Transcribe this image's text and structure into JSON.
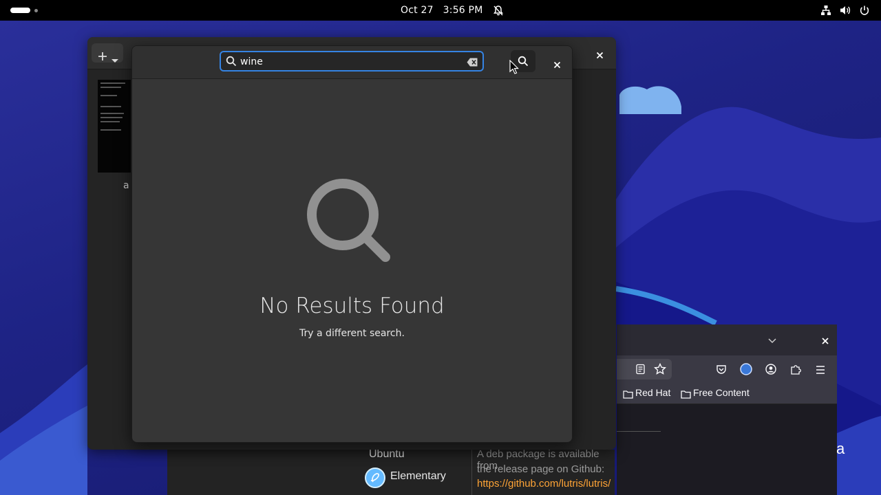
{
  "topbar": {
    "date": "Oct 27",
    "time": "3:56 PM"
  },
  "background_window": {
    "thumbnail_label": "a"
  },
  "search_dialog": {
    "search_value": "wine",
    "empty_title": "No Results Found",
    "empty_subtitle": "Try a different search."
  },
  "firefox": {
    "bookmarks": [
      "Red Hat",
      "Free Content"
    ]
  },
  "webpage": {
    "ubuntu": "Ubuntu",
    "elementary": "Elementary",
    "deb_line1": "A deb package is available from",
    "deb_line2": "the release page on Github:",
    "link": "https://github.com/lutris/lutris/",
    "side_letter": "a"
  },
  "colors": {
    "accent": "#3584e4",
    "link": "#ffa436",
    "panel": "#000000"
  }
}
